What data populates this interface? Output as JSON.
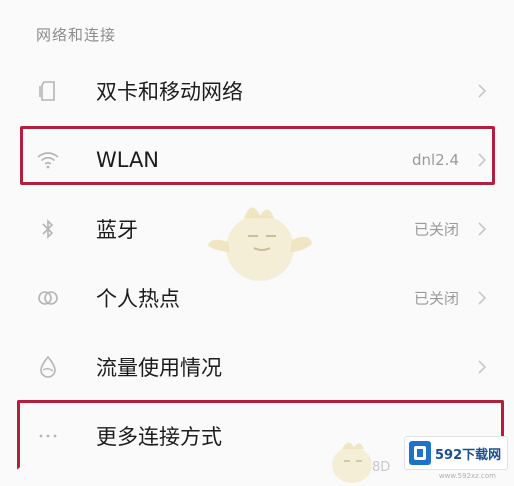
{
  "section": {
    "title": "网络和连接"
  },
  "rows": [
    {
      "label": "双卡和移动网络",
      "value": "",
      "icon": "sim-card-icon"
    },
    {
      "label": "WLAN",
      "value": "dnl2.4",
      "icon": "wifi-icon"
    },
    {
      "label": "蓝牙",
      "value": "已关闭",
      "icon": "bluetooth-icon"
    },
    {
      "label": "个人热点",
      "value": "已关闭",
      "icon": "hotspot-icon"
    },
    {
      "label": "流量使用情况",
      "value": "",
      "icon": "data-usage-icon"
    },
    {
      "label": "更多连接方式",
      "value": "",
      "icon": "more-dots-icon"
    }
  ],
  "watermark": {
    "site": "592下载网",
    "url": "www.592xz.com",
    "mascot_text": "8D"
  },
  "colors": {
    "highlight": "#b3203d",
    "background": "#fafafa",
    "secondary_text": "#9a9a9a"
  }
}
